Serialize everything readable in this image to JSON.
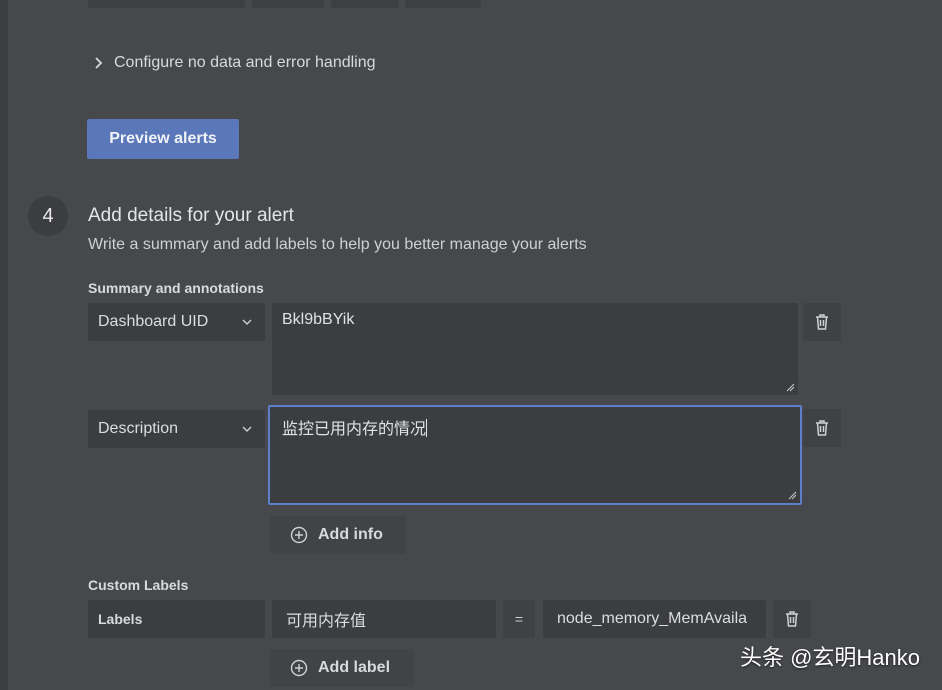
{
  "alert_config": {
    "no_data_toggle": "Configure no data and error handling",
    "preview_button": "Preview alerts"
  },
  "step": {
    "number": "4",
    "title": "Add details for your alert",
    "subtitle": "Write a summary and add labels to help you better manage your alerts"
  },
  "summary": {
    "heading": "Summary and annotations",
    "rows": [
      {
        "key": "Dashboard UID",
        "value": "Bkl9bBYik"
      },
      {
        "key": "Description",
        "value": "监控已用内存的情况"
      }
    ],
    "add_info": "Add info"
  },
  "custom_labels": {
    "heading": "Custom Labels",
    "key_header": "Labels",
    "label_key": "可用内存值",
    "operator": "=",
    "label_value": "node_memory_MemAvaila",
    "add_label": "Add label"
  },
  "watermark": "头条 @玄明Hanko",
  "colors": {
    "background": "#46484c",
    "field": "#3b3d41",
    "primary_button": "#5a77b9",
    "focus_border": "#5b7fc8"
  }
}
